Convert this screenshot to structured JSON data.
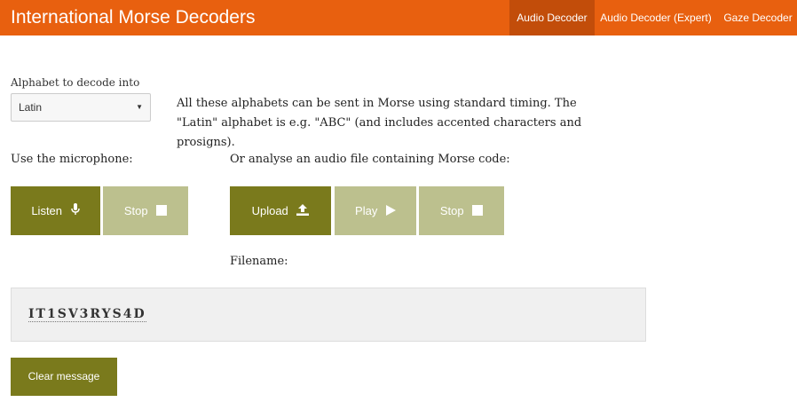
{
  "app": {
    "title": "International Morse Decoders"
  },
  "nav": {
    "items": [
      {
        "label": "Audio Decoder",
        "active": true
      },
      {
        "label": "Audio Decoder (Expert)",
        "active": false
      },
      {
        "label": "Gaze Decoder",
        "active": false
      }
    ]
  },
  "alphabet": {
    "label": "Alphabet to decode into",
    "selected": "Latin",
    "description": "All these alphabets can be sent in Morse using standard timing. The \"Latin\" alphabet is e.g. \"ABC\" (and includes accented characters and prosigns)."
  },
  "microphone": {
    "label": "Use the microphone:",
    "listen_label": "Listen",
    "stop_label": "Stop"
  },
  "file": {
    "label": "Or analyse an audio file containing Morse code:",
    "upload_label": "Upload",
    "play_label": "Play",
    "stop_label": "Stop",
    "filename_label": "Filename:"
  },
  "output": {
    "decoded_text": "IT1SV3RYS4D"
  },
  "clear": {
    "label": "Clear message"
  },
  "colors": {
    "nav_bg": "#e8600f",
    "nav_active": "#c24d0a",
    "button_active": "#7a7a1c",
    "button_disabled": "#bcc08e"
  },
  "icons": {
    "listen": "microphone-icon",
    "stop": "stop-square-icon",
    "upload": "upload-icon",
    "play": "play-icon",
    "select": "caret-down-icon"
  }
}
